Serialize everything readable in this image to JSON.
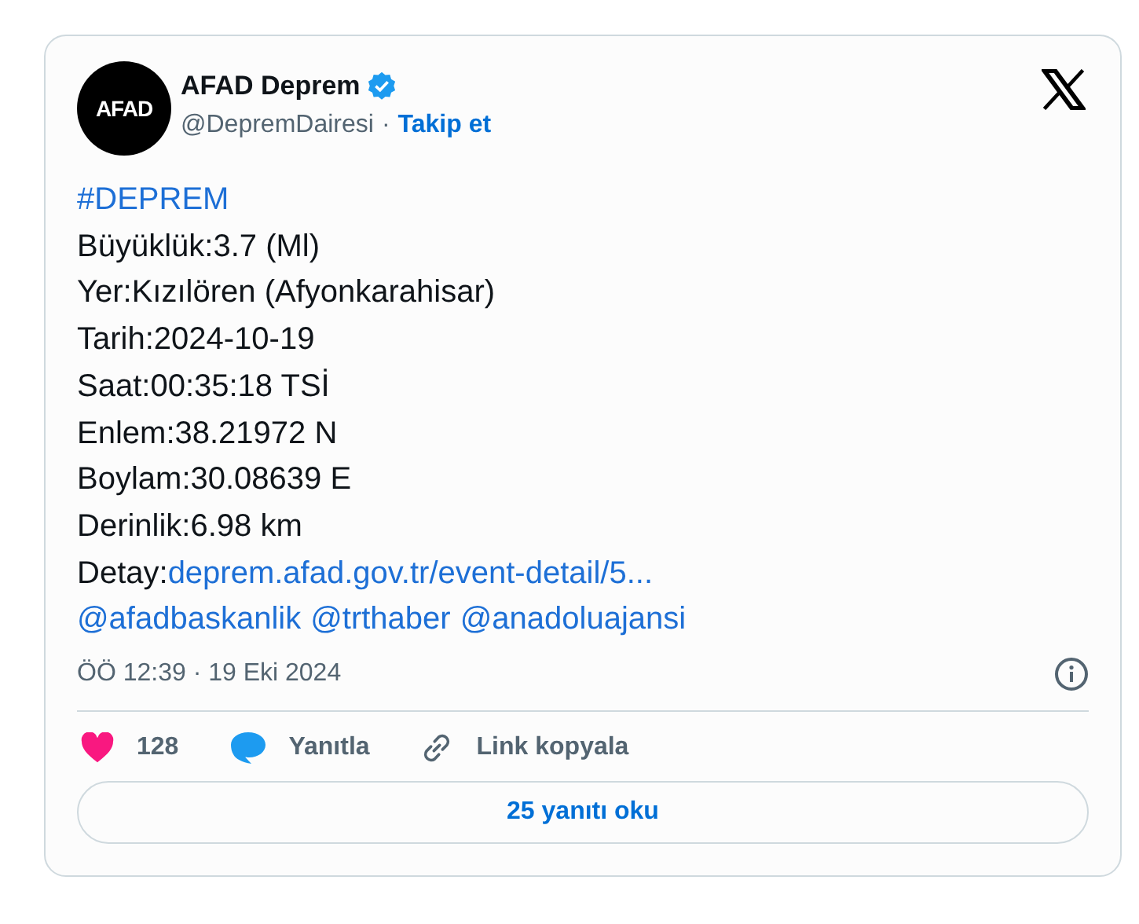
{
  "author": {
    "avatar_text": "AFAD",
    "name": "AFAD Deprem",
    "verified": true,
    "handle": "@DepremDairesi",
    "separator": "·",
    "follow": "Takip et"
  },
  "body": [
    [
      {
        "kind": "link",
        "text": "#DEPREM"
      }
    ],
    [
      {
        "kind": "plain",
        "text": "Büyüklük:3.7 (Ml)"
      }
    ],
    [
      {
        "kind": "plain",
        "text": "Yer:Kızılören (Afyonkarahisar)"
      }
    ],
    [
      {
        "kind": "plain",
        "text": "Tarih:2024-10-19"
      }
    ],
    [
      {
        "kind": "plain",
        "text": "Saat:00:35:18 TSİ"
      }
    ],
    [
      {
        "kind": "plain",
        "text": "Enlem:38.21972 N"
      }
    ],
    [
      {
        "kind": "plain",
        "text": "Boylam:30.08639 E"
      }
    ],
    [
      {
        "kind": "plain",
        "text": "Derinlik:6.98 km"
      }
    ],
    [
      {
        "kind": "plain",
        "text": "Detay:"
      },
      {
        "kind": "link",
        "text": "deprem.afad.gov.tr/event-detail/5..."
      }
    ],
    [
      {
        "kind": "link",
        "text": "@afadbaskanlik"
      },
      {
        "kind": "link",
        "text": "@trthaber"
      },
      {
        "kind": "link",
        "text": "@anadoluajansi"
      }
    ]
  ],
  "timestamp": "ÖÖ 12:39 · 19 Eki 2024",
  "actions": [
    {
      "kind": "like",
      "label": "128"
    },
    {
      "kind": "reply",
      "label": "Yanıtla"
    },
    {
      "kind": "copy",
      "label": "Link kopyala"
    }
  ],
  "read_replies": "25 yanıtı oku"
}
